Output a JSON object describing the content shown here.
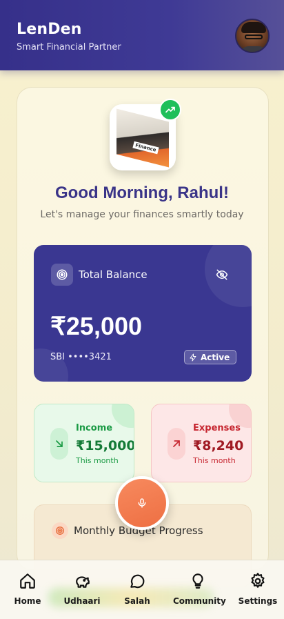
{
  "header": {
    "app_name": "LenDen",
    "tagline": "Smart Financial Partner",
    "avatar_icon": "user-avatar"
  },
  "hero": {
    "book_label": "Finance",
    "badge_icon": "trending-up-icon",
    "greeting": "Good Morning, Rahul!",
    "subtitle": "Let's manage your finances smartly today"
  },
  "balance": {
    "title": "Total Balance",
    "amount": "₹25,000",
    "account": "SBI ••••3421",
    "status": "Active",
    "icon": "target-icon",
    "toggle_icon": "eye-off-icon"
  },
  "income": {
    "label": "Income",
    "amount": "₹15,000",
    "period": "This month",
    "color": "#1a9a44"
  },
  "expenses": {
    "label": "Expenses",
    "amount": "₹8,240",
    "period": "This month",
    "color": "#c6252f"
  },
  "budget": {
    "title": "Monthly Budget Progress"
  },
  "mic": {
    "icon": "microphone-icon"
  },
  "nav": {
    "items": [
      {
        "label": "Home",
        "icon": "home-icon"
      },
      {
        "label": "Udhaari",
        "icon": "piggy-bank-icon"
      },
      {
        "label": "Salah",
        "icon": "chat-bubble-icon"
      },
      {
        "label": "Community",
        "icon": "lightbulb-icon"
      },
      {
        "label": "Settings",
        "icon": "gear-icon"
      }
    ]
  },
  "colors": {
    "primary": "#3a3791",
    "accent_orange": "#ee6f43",
    "success_green": "#1fbf5a"
  }
}
